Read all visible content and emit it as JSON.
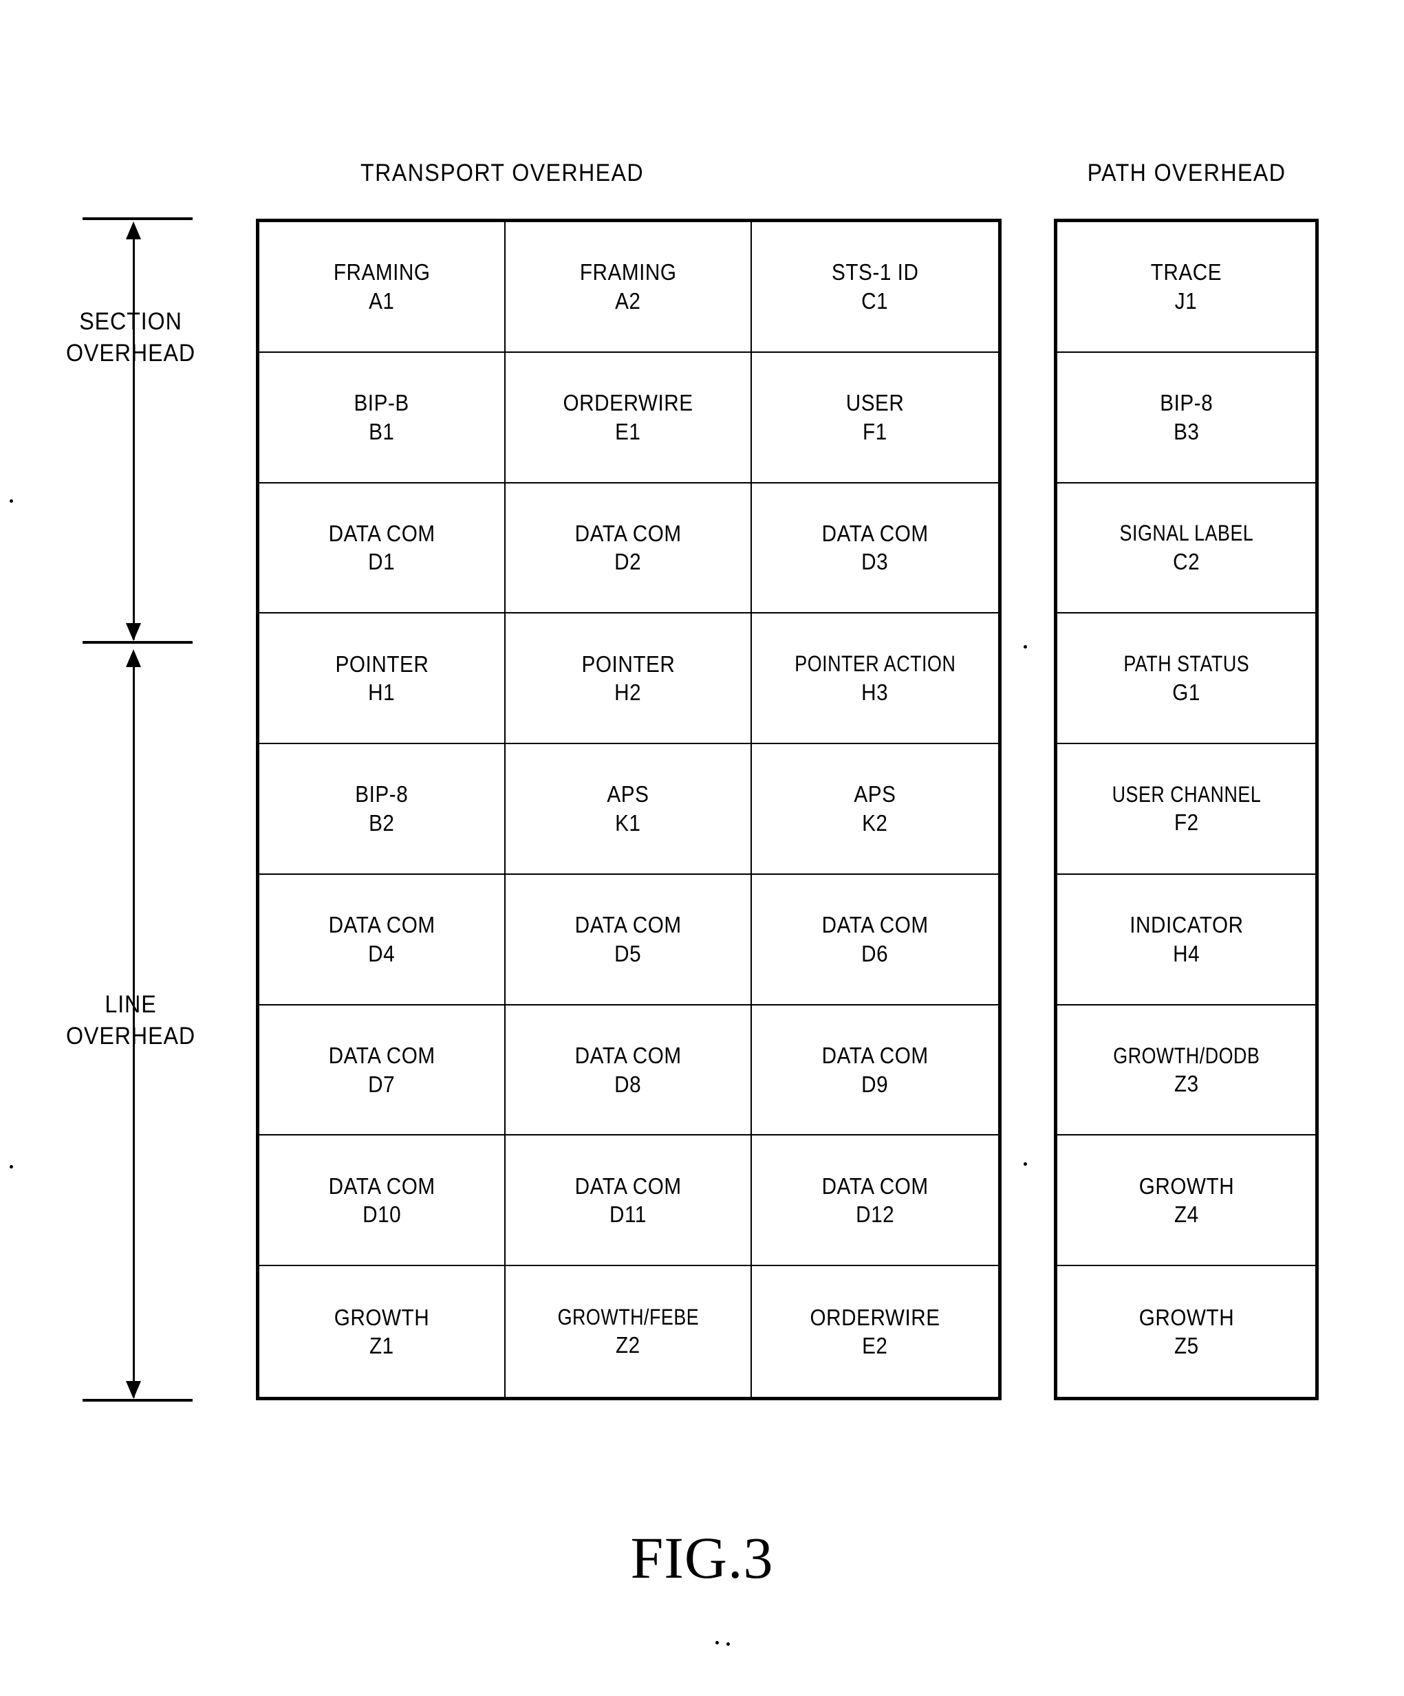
{
  "figure": {
    "caption": "FIG.3",
    "transport_title": "TRANSPORT OVERHEAD",
    "path_title": "PATH OVERHEAD"
  },
  "side_labels": [
    {
      "line1": "SECTION",
      "line2": "OVERHEAD"
    },
    {
      "line1": "LINE",
      "line2": "OVERHEAD"
    }
  ],
  "transport_overhead": {
    "rows": [
      [
        {
          "name": "FRAMING",
          "code": "A1"
        },
        {
          "name": "FRAMING",
          "code": "A2"
        },
        {
          "name": "STS-1 ID",
          "code": "C1"
        }
      ],
      [
        {
          "name": "BIP-B",
          "code": "B1"
        },
        {
          "name": "ORDERWIRE",
          "code": "E1"
        },
        {
          "name": "USER",
          "code": "F1"
        }
      ],
      [
        {
          "name": "DATA COM",
          "code": "D1"
        },
        {
          "name": "DATA COM",
          "code": "D2"
        },
        {
          "name": "DATA COM",
          "code": "D3"
        }
      ],
      [
        {
          "name": "POINTER",
          "code": "H1"
        },
        {
          "name": "POINTER",
          "code": "H2"
        },
        {
          "name": "POINTER ACTION",
          "code": "H3"
        }
      ],
      [
        {
          "name": "BIP-8",
          "code": "B2"
        },
        {
          "name": "APS",
          "code": "K1"
        },
        {
          "name": "APS",
          "code": "K2"
        }
      ],
      [
        {
          "name": "DATA COM",
          "code": "D4"
        },
        {
          "name": "DATA COM",
          "code": "D5"
        },
        {
          "name": "DATA COM",
          "code": "D6"
        }
      ],
      [
        {
          "name": "DATA COM",
          "code": "D7"
        },
        {
          "name": "DATA COM",
          "code": "D8"
        },
        {
          "name": "DATA COM",
          "code": "D9"
        }
      ],
      [
        {
          "name": "DATA COM",
          "code": "D10"
        },
        {
          "name": "DATA COM",
          "code": "D11"
        },
        {
          "name": "DATA COM",
          "code": "D12"
        }
      ],
      [
        {
          "name": "GROWTH",
          "code": "Z1"
        },
        {
          "name": "GROWTH/FEBE",
          "code": "Z2"
        },
        {
          "name": "ORDERWIRE",
          "code": "E2"
        }
      ]
    ]
  },
  "path_overhead": {
    "rows": [
      {
        "name": "TRACE",
        "code": "J1"
      },
      {
        "name": "BIP-8",
        "code": "B3"
      },
      {
        "name": "SIGNAL LABEL",
        "code": "C2"
      },
      {
        "name": "PATH STATUS",
        "code": "G1"
      },
      {
        "name": "USER CHANNEL",
        "code": "F2"
      },
      {
        "name": "INDICATOR",
        "code": "H4"
      },
      {
        "name": "GROWTH/DODB",
        "code": "Z3"
      },
      {
        "name": "GROWTH",
        "code": "Z4"
      },
      {
        "name": "GROWTH",
        "code": "Z5"
      }
    ]
  }
}
